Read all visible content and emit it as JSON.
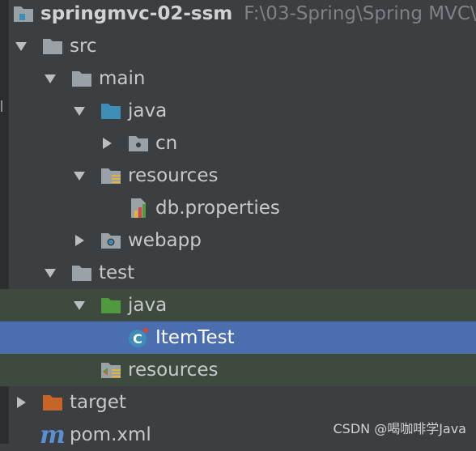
{
  "project": {
    "name": "springmvc-02-ssm",
    "path": "F:\\03-Spring\\Spring MVC\\"
  },
  "tree": {
    "src": "src",
    "main": "main",
    "main_java": "java",
    "cn": "cn",
    "main_resources": "resources",
    "db_properties": "db.properties",
    "webapp": "webapp",
    "test": "test",
    "test_java": "java",
    "item_test": "ItemTest",
    "test_resources": "resources",
    "target": "target",
    "pom": "pom.xml"
  },
  "watermark": "CSDN @喝咖啡学Java",
  "colors": {
    "background": "#3c3f41",
    "selection": "#4b6eaf",
    "test_source_highlight": "#3f4a3f",
    "folder_gray": "#9aa1a7",
    "source_folder_blue": "#3c8db8",
    "test_folder_green": "#4f9a3e",
    "excluded_folder_orange": "#c86428"
  }
}
